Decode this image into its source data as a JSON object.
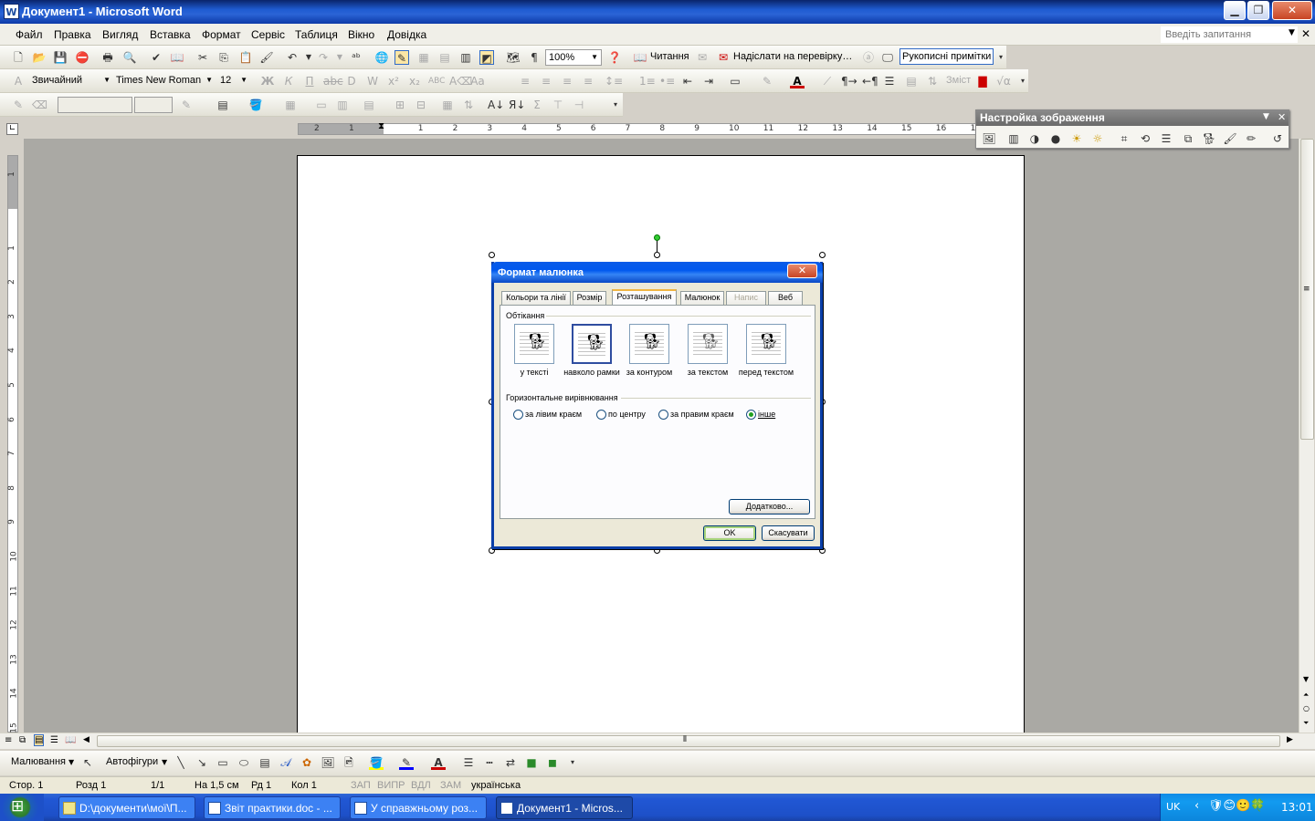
{
  "window": {
    "title": "Документ1 - Microsoft Word",
    "app_icon": "W"
  },
  "menubar": {
    "items": [
      "Файл",
      "Правка",
      "Вигляд",
      "Вставка",
      "Формат",
      "Сервіс",
      "Таблиця",
      "Вікно",
      "Довідка"
    ],
    "ask_placeholder": "Введіть запитання"
  },
  "standard_toolbar": {
    "zoom": "100%",
    "reading_label": "Читання",
    "send_review_label": "Надіслати на перевірку…",
    "ink_label": "Рукописні примітки"
  },
  "formatting_toolbar": {
    "style": "Звичайний",
    "font": "Times New Roman",
    "size": "12",
    "toc_label": "Зміст"
  },
  "picture_toolbar": {
    "title": "Настройка зображення"
  },
  "ruler": {
    "h_ticks": [
      "2",
      "1",
      "1",
      "2",
      "3",
      "4",
      "5",
      "6",
      "7",
      "8",
      "9",
      "10",
      "11",
      "12",
      "13",
      "14",
      "15",
      "16",
      "17"
    ],
    "v_ticks": [
      "1",
      "1",
      "2",
      "3",
      "4",
      "5",
      "6",
      "7",
      "8",
      "9",
      "10",
      "11",
      "12",
      "13",
      "14",
      "15"
    ]
  },
  "dialog": {
    "title": "Формат малюнка",
    "tabs": [
      "Кольори та лінії",
      "Розмір",
      "Розташування",
      "Малюнок",
      "Напис",
      "Веб"
    ],
    "active_tab": "Розташування",
    "disabled_tab": "Напис",
    "wrap_group": "Обтікання",
    "wrap_options": [
      "у тексті",
      "навколо рамки",
      "за контуром",
      "за текстом",
      "перед текстом"
    ],
    "selected_wrap": "навколо рамки",
    "align_group": "Горизонтальне вирівнювання",
    "align_options": [
      "за лівим краєм",
      "по центру",
      "за правим краєм",
      "інше"
    ],
    "selected_align": "інше",
    "advanced_button": "Додатково...",
    "ok_button": "OK",
    "cancel_button": "Скасувати"
  },
  "drawing_toolbar": {
    "draw_label": "Малювання",
    "autoshapes_label": "Автофігури"
  },
  "statusbar": {
    "page": "Стор. 1",
    "section": "Розд 1",
    "pages": "1/1",
    "at": "На 1,5 см",
    "line": "Рд 1",
    "col": "Кол 1",
    "rec": "ЗАП",
    "trk": "ВИПР",
    "ext": "ВДЛ",
    "ovr": "ЗАМ",
    "language": "українська"
  },
  "taskbar": {
    "tasks": [
      "D:\\документи\\мої\\П...",
      "Звіт практики.doc - ...",
      "У справжньому роз...",
      "Документ1 - Micros..."
    ],
    "active_task": 3,
    "lang": "UK",
    "clock": "13:01"
  }
}
